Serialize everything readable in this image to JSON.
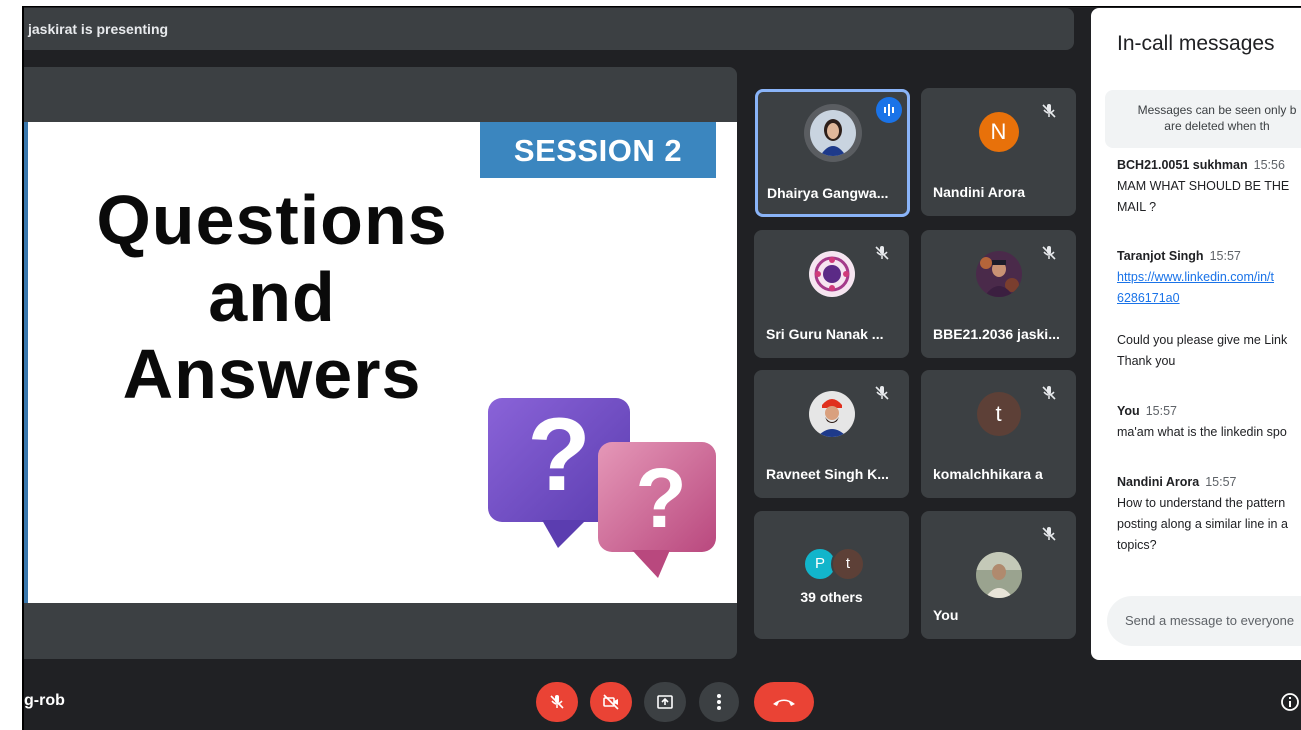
{
  "presenting": {
    "text": "jaskirat is presenting"
  },
  "slide": {
    "session": "SESSION 2",
    "title_lines": [
      "Questions",
      "and",
      "Answers"
    ],
    "mark": "?"
  },
  "participants": [
    {
      "name": "Dhairya Gangwa...",
      "speaking": true,
      "avatar": "photo"
    },
    {
      "name": "Nandini Arora",
      "avatar_letter": "N",
      "avatar_color": "#e8710a"
    },
    {
      "name": "Sri Guru Nanak ...",
      "avatar": "logo"
    },
    {
      "name": "BBE21.2036 jaski...",
      "avatar": "photo"
    },
    {
      "name": "Ravneet Singh K...",
      "avatar": "photo"
    },
    {
      "name": "komalchhikara a",
      "avatar_letter": "t",
      "avatar_color": "#5d4037"
    },
    {
      "name": "39 others",
      "mini_avatars": [
        "P",
        "t"
      ]
    },
    {
      "name": "You",
      "avatar": "photo"
    }
  ],
  "chat": {
    "title": "In-call messages",
    "notice": [
      "Messages can be seen only b",
      "are deleted when th"
    ],
    "messages": [
      {
        "sender": "BCH21.0051 sukhman",
        "time": "15:56",
        "lines": [
          "MAM WHAT SHOULD BE THE",
          "MAIL ?"
        ]
      },
      {
        "sender": "Taranjot Singh",
        "time": "15:57",
        "link_lines": [
          "https://www.linkedin.com/in/t",
          "6286171a0"
        ]
      },
      {
        "lines": [
          "Could you please give me Link",
          "Thank you"
        ]
      },
      {
        "sender": "You",
        "time": "15:57",
        "lines": [
          "ma'am what is the linkedin spo"
        ]
      },
      {
        "sender": "Nandini Arora",
        "time": "15:57",
        "lines": [
          "How to understand the pattern",
          "posting along a similar line in a",
          "topics?"
        ]
      }
    ],
    "input_placeholder": "Send a message to everyone"
  },
  "meeting": {
    "code": "g-rob"
  },
  "colors": {
    "background": "#202124",
    "tile": "#3c4043",
    "end_call": "#ea4335",
    "accent": "#8ab4f8"
  },
  "icons": [
    "mic-off-icon",
    "camera-off-icon",
    "present-icon",
    "more-icon",
    "end-call-icon",
    "info-icon",
    "speaking-icon"
  ]
}
